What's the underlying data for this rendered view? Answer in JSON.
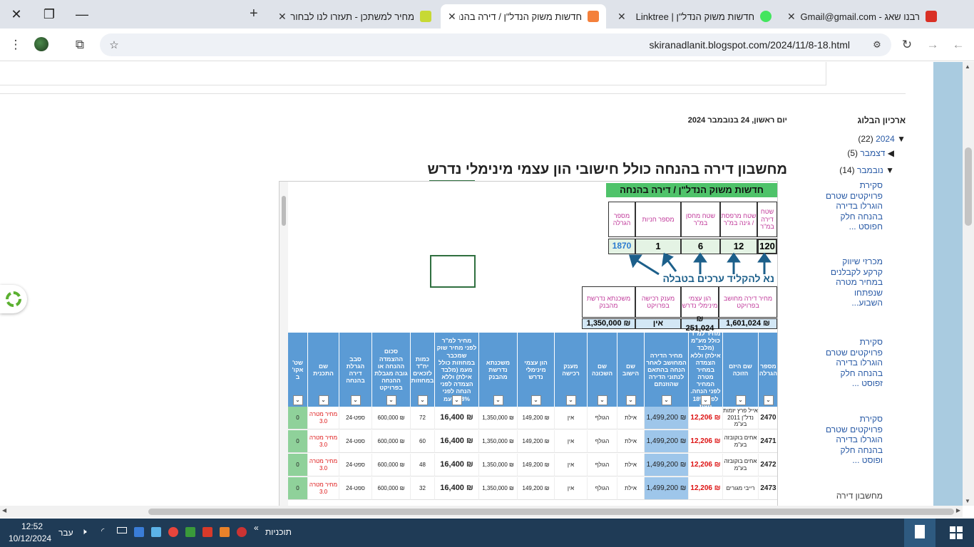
{
  "tabs": [
    {
      "title": "רבנו שאג - Gmail - Gmail@gmail.com",
      "fav_color": "#d93025"
    },
    {
      "title": "חדשות משוק הנדל\"ן | Linktree",
      "fav_color": "#43e55e"
    },
    {
      "title": "חדשות משוק הנדל\"ן / דירה בהנחה",
      "fav_color": "#f4803b"
    },
    {
      "title": "מחיר למשתכן - תעזרו לנו לבחור",
      "fav_color": "#c7d934"
    }
  ],
  "browser": {
    "url": "skiranadlanit.blogspot.com/2024/11/8-18.html"
  },
  "post": {
    "date": "יום ראשון, 24 בנובמבר 2024",
    "title": "מחשבון דירה בהנחה כולל חישובי הון עצמי מינימלי נדרש"
  },
  "sidebar": {
    "title": "ארכיון הבלוג",
    "year": "2024",
    "year_count": "(22)",
    "dec": "דצמבר",
    "dec_count": "(5)",
    "nov": "נובמבר",
    "nov_count": "(14)",
    "posts": [
      "סקירת פרויקטים שטרם הוגרלו בדירה בהנחה חלק חפוסט ...",
      "מכרזי שיווק קרקע לקבלנים במחיר מטרה שנפתחו השבוע...",
      "סקירת פרויקטים שטרם הוגרלו בדירה בהנחה חלק זפוסט ...",
      "סקירת פרויקטים שטרם הוגרלו בדירה בהנחה חלק ופוסט ..."
    ],
    "cut_post": "מחשבון דירה"
  },
  "sheet": {
    "header": "חדשות משוק הנדל\"ן / דירה בהנחה",
    "top_headers": [
      "שטח דירה במ\"ר",
      "שטח מרפסת / גינה במ\"ר",
      "שטח מחסן במ\"ר",
      "מספר חניות",
      "מספר הגרלה"
    ],
    "top_values": [
      "120",
      "12",
      "6",
      "1",
      "1870"
    ],
    "instruction": "נא להקליד ערכים בטבלה",
    "mid_headers": [
      "מחיר דירה מחושב בפרויקט",
      "הון עצמי מינימלי נדרש",
      "מענק רכישה בפרויקט",
      "משכנתא נדרשת מהבנק"
    ],
    "mid_values": [
      "₪ 1,601,024",
      "₪ 251,024",
      "אין",
      "₪ 1,350,000"
    ],
    "columns": [
      "מספר הגרלה",
      "שם היזם הזוכה",
      "מחיר למ\"ר כולל מע\"מ (מלבד אילת) וללא הצמדה במחיר מטרה המחיר לפני הנחה. לפני 18% מעמ",
      "מחיר הדירה המחושב לאחר הנחה בהתאם לנתוני הדירה שהוזנתם",
      "שם הישוב",
      "שם השכונה",
      "מענק רכישה",
      "הון עצמי מינימלי נדרש",
      "משכנתא נדרשת מהבנק",
      "מחיר למ\"ר לפני מחיר שוק שמכבר במחוזות כולל מעמ (מלבד אילת) וללא הצמדה לפני הנחה לפני 18% מעמ",
      "כמות יח\"ד לזכאים במחוזות",
      "סכום ההצמדה ההנחה או גובה מגבלת ההנחה בפרויקט",
      "סבב הגרלת דירה בהנחה",
      "שם התכנית",
      "שט' אקו' ב"
    ],
    "rows": [
      [
        "2470",
        "אייל פרץ יזמות נדל\"ן 2011 בע\"מ",
        "₪ 12,206",
        "₪ 1,499,200",
        "אילת",
        "הגולף",
        "אין",
        "₪ 149,200",
        "₪ 1,350,000",
        "₪ 16,400",
        "72",
        "₪ 600,000",
        "ספט-24",
        "מחיר מטרה 3.0",
        "0"
      ],
      [
        "2471",
        "אחים בוקובזה בע\"מ",
        "₪ 12,206",
        "₪ 1,499,200",
        "אילת",
        "הגולף",
        "אין",
        "₪ 149,200",
        "₪ 1,350,000",
        "₪ 16,400",
        "60",
        "₪ 600,000",
        "ספט-24",
        "מחיר מטרה 3.0",
        "0"
      ],
      [
        "2472",
        "אחים בוקובזה בע\"מ",
        "₪ 12,206",
        "₪ 1,499,200",
        "אילת",
        "הגולף",
        "אין",
        "₪ 149,200",
        "₪ 1,350,000",
        "₪ 16,400",
        "48",
        "₪ 600,000",
        "ספט-24",
        "מחיר מטרה 3.0",
        "0"
      ],
      [
        "2473",
        "רייבי מגורים",
        "₪ 12,206",
        "₪ 1,499,200",
        "אילת",
        "הגולף",
        "אין",
        "₪ 149,200",
        "₪ 1,350,000",
        "₪ 16,400",
        "32",
        "₪ 600,000",
        "ספט-24",
        "מחיר מטרה 3.0",
        "0"
      ]
    ]
  },
  "taskbar": {
    "time": "12:52",
    "date": "10/12/2024",
    "lang": "עבר",
    "programs": "תוכניות"
  }
}
